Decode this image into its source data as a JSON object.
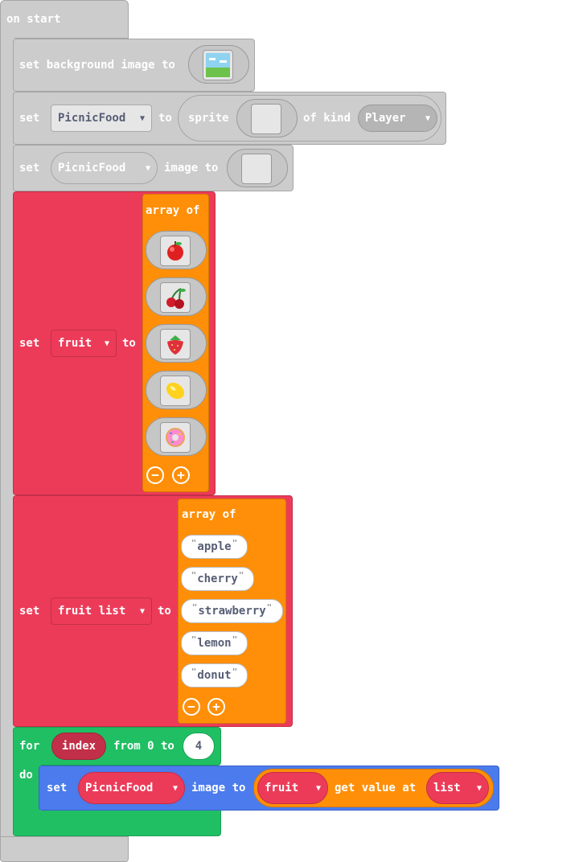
{
  "event": {
    "label": "on start"
  },
  "bg_block": {
    "label": "set background image to",
    "icon": "landscape-icon"
  },
  "sprite_block": {
    "set_label": "set",
    "var": "PicnicFood",
    "to_label": "to",
    "sprite_label": "sprite",
    "of_kind_label": "of kind",
    "kind": "Player"
  },
  "image_block": {
    "set_label": "set",
    "var": "PicnicFood",
    "image_to_label": "image to"
  },
  "fruit_block": {
    "set_label": "set",
    "var": "fruit",
    "to_label": "to",
    "array_label": "array of",
    "images": [
      "apple-icon",
      "cherry-icon",
      "strawberry-icon",
      "lemon-icon",
      "donut-icon"
    ]
  },
  "list_block": {
    "set_label": "set",
    "var": "fruit list",
    "to_label": "to",
    "array_label": "array of",
    "items": [
      "apple",
      "cherry",
      "strawberry",
      "lemon",
      "donut"
    ]
  },
  "for_block": {
    "for_label": "for",
    "var": "index",
    "from_label": "from 0 to",
    "to_value": "4",
    "do_label": "do"
  },
  "inner_block": {
    "set_label": "set",
    "var": "PicnicFood",
    "image_to_label": "image to",
    "array_var": "fruit",
    "get_label": "get value at",
    "index_var": "list"
  },
  "colors": {
    "event": "#cccccc",
    "variables": "#ec3b59",
    "arrays": "#ff8f08",
    "loops": "#20bf63",
    "sprites": "#4b7bec"
  }
}
